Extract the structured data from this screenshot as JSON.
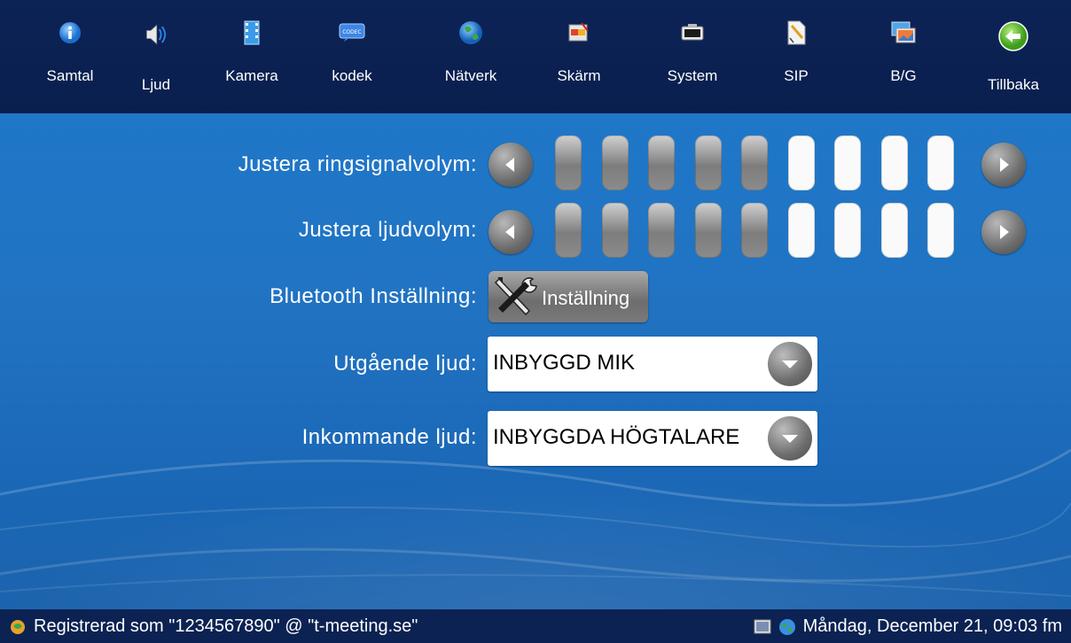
{
  "nav": {
    "items": [
      {
        "label": "Samtal",
        "icon": "info-icon"
      },
      {
        "label": "Ljud",
        "icon": "speaker-icon"
      },
      {
        "label": "Kamera",
        "icon": "film-icon"
      },
      {
        "label": "kodek",
        "icon": "codec-icon"
      },
      {
        "label": "Nätverk",
        "icon": "globe-icon"
      },
      {
        "label": "Skärm",
        "icon": "screen-icon"
      },
      {
        "label": "System",
        "icon": "system-icon"
      },
      {
        "label": "SIP",
        "icon": "document-icon"
      },
      {
        "label": "B/G",
        "icon": "background-image-icon"
      },
      {
        "label": "Tillbaka",
        "icon": "back-arrow-icon"
      }
    ],
    "codec_icon_text": "CODEC"
  },
  "settings": {
    "ring_volume": {
      "label": "Justera ringsignalvolym:",
      "level": 5,
      "max": 9
    },
    "audio_volume": {
      "label": "Justera ljudvolym:",
      "level": 5,
      "max": 9
    },
    "bluetooth": {
      "label": "Bluetooth Inställning:",
      "button_label": "Inställning"
    },
    "output_audio": {
      "label": "Utgående ljud:",
      "value": "INBYGGD MIK"
    },
    "input_audio": {
      "label": "Inkommande ljud:",
      "value": "INBYGGDA HÖGTALARE"
    }
  },
  "status": {
    "registration": "Registrerad som \"1234567890\" @ \"t-meeting.se\"",
    "datetime": "Måndag, December 21, 09:03 fm"
  },
  "colors": {
    "background_blue": "#1f77c8",
    "nav_bar": "#0c2356",
    "status_bar": "#0c2252",
    "slider_on": "#8b8b8b",
    "slider_off": "#fafafa",
    "back_green": "#5fbf2a"
  }
}
